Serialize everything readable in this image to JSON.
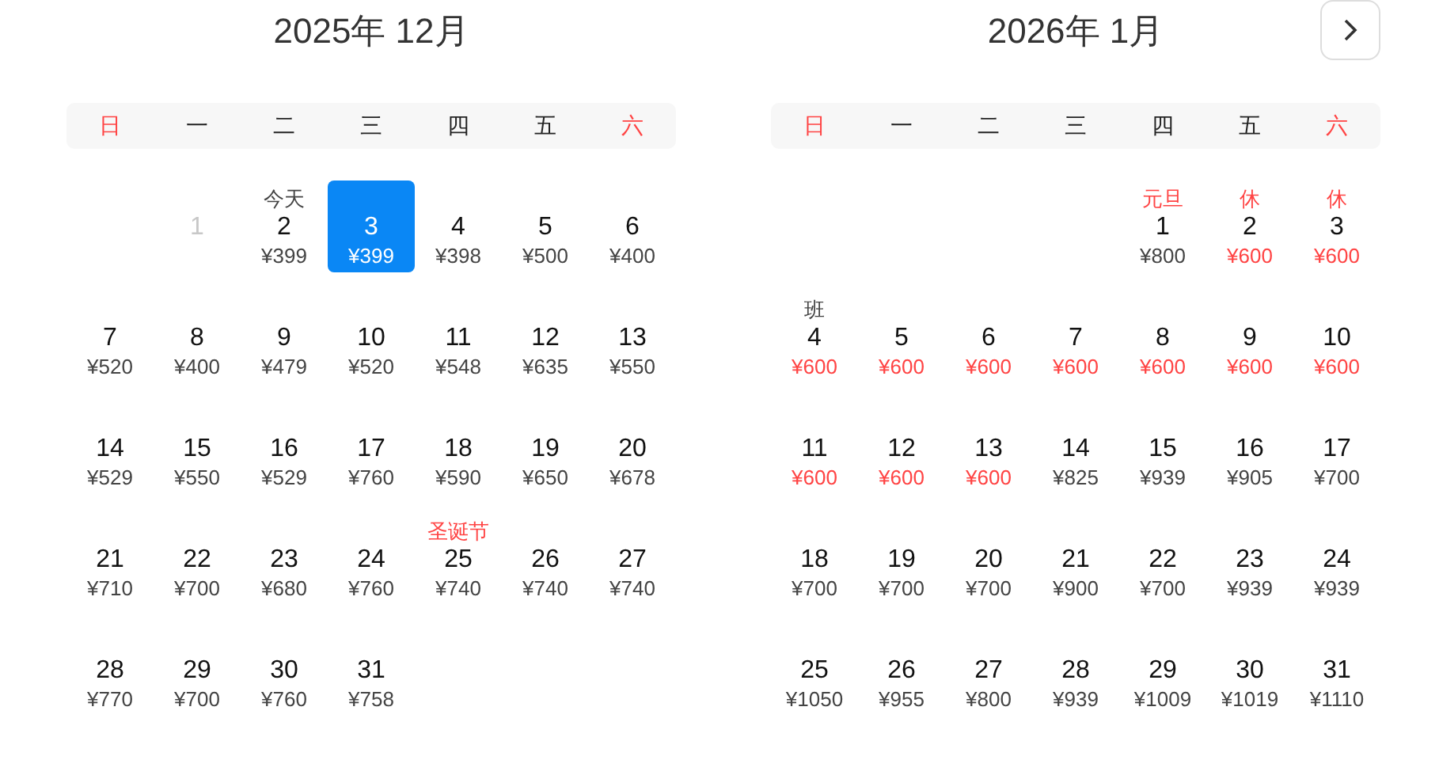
{
  "months": [
    {
      "title": "2025年 12月",
      "weekdays": [
        {
          "label": "日",
          "weekend": true
        },
        {
          "label": "一",
          "weekend": false
        },
        {
          "label": "二",
          "weekend": false
        },
        {
          "label": "三",
          "weekend": false
        },
        {
          "label": "四",
          "weekend": false
        },
        {
          "label": "五",
          "weekend": false
        },
        {
          "label": "六",
          "weekend": true
        }
      ],
      "weeks": [
        [
          {
            "kind": "blank"
          },
          {
            "kind": "date",
            "d": "1",
            "disabled": true,
            "selected": false
          },
          {
            "kind": "date",
            "d": "2",
            "price": "¥399",
            "note": "今天",
            "holiday": false,
            "disabled": false,
            "selected": false,
            "deal": false
          },
          {
            "kind": "date",
            "d": "3",
            "price": "¥399",
            "disabled": false,
            "selected": true,
            "deal": false
          },
          {
            "kind": "date",
            "d": "4",
            "price": "¥398",
            "disabled": false,
            "selected": false,
            "deal": false
          },
          {
            "kind": "date",
            "d": "5",
            "price": "¥500",
            "disabled": false,
            "selected": false,
            "deal": false
          },
          {
            "kind": "date",
            "d": "6",
            "price": "¥400",
            "disabled": false,
            "selected": false,
            "deal": false
          }
        ],
        [
          {
            "kind": "date",
            "d": "7",
            "price": "¥520",
            "disabled": false,
            "selected": false,
            "deal": false
          },
          {
            "kind": "date",
            "d": "8",
            "price": "¥400",
            "disabled": false,
            "selected": false,
            "deal": false
          },
          {
            "kind": "date",
            "d": "9",
            "price": "¥479",
            "disabled": false,
            "selected": false,
            "deal": false
          },
          {
            "kind": "date",
            "d": "10",
            "price": "¥520",
            "disabled": false,
            "selected": false,
            "deal": false
          },
          {
            "kind": "date",
            "d": "11",
            "price": "¥548",
            "disabled": false,
            "selected": false,
            "deal": false
          },
          {
            "kind": "date",
            "d": "12",
            "price": "¥635",
            "disabled": false,
            "selected": false,
            "deal": false
          },
          {
            "kind": "date",
            "d": "13",
            "price": "¥550",
            "disabled": false,
            "selected": false,
            "deal": false
          }
        ],
        [
          {
            "kind": "date",
            "d": "14",
            "price": "¥529",
            "disabled": false,
            "selected": false,
            "deal": false
          },
          {
            "kind": "date",
            "d": "15",
            "price": "¥550",
            "disabled": false,
            "selected": false,
            "deal": false
          },
          {
            "kind": "date",
            "d": "16",
            "price": "¥529",
            "disabled": false,
            "selected": false,
            "deal": false
          },
          {
            "kind": "date",
            "d": "17",
            "price": "¥760",
            "disabled": false,
            "selected": false,
            "deal": false
          },
          {
            "kind": "date",
            "d": "18",
            "price": "¥590",
            "disabled": false,
            "selected": false,
            "deal": false
          },
          {
            "kind": "date",
            "d": "19",
            "price": "¥650",
            "disabled": false,
            "selected": false,
            "deal": false
          },
          {
            "kind": "date",
            "d": "20",
            "price": "¥678",
            "disabled": false,
            "selected": false,
            "deal": false
          }
        ],
        [
          {
            "kind": "date",
            "d": "21",
            "price": "¥710",
            "disabled": false,
            "selected": false,
            "deal": false
          },
          {
            "kind": "date",
            "d": "22",
            "price": "¥700",
            "disabled": false,
            "selected": false,
            "deal": false
          },
          {
            "kind": "date",
            "d": "23",
            "price": "¥680",
            "disabled": false,
            "selected": false,
            "deal": false
          },
          {
            "kind": "date",
            "d": "24",
            "price": "¥760",
            "disabled": false,
            "selected": false,
            "deal": false
          },
          {
            "kind": "date",
            "d": "25",
            "price": "¥740",
            "note": "圣诞节",
            "holiday": true,
            "disabled": false,
            "selected": false,
            "deal": false
          },
          {
            "kind": "date",
            "d": "26",
            "price": "¥740",
            "disabled": false,
            "selected": false,
            "deal": false
          },
          {
            "kind": "date",
            "d": "27",
            "price": "¥740",
            "disabled": false,
            "selected": false,
            "deal": false
          }
        ],
        [
          {
            "kind": "date",
            "d": "28",
            "price": "¥770",
            "disabled": false,
            "selected": false,
            "deal": false
          },
          {
            "kind": "date",
            "d": "29",
            "price": "¥700",
            "disabled": false,
            "selected": false,
            "deal": false
          },
          {
            "kind": "date",
            "d": "30",
            "price": "¥760",
            "disabled": false,
            "selected": false,
            "deal": false
          },
          {
            "kind": "date",
            "d": "31",
            "price": "¥758",
            "disabled": false,
            "selected": false,
            "deal": false
          }
        ]
      ]
    },
    {
      "title": "2026年 1月",
      "weekdays": [
        {
          "label": "日",
          "weekend": true
        },
        {
          "label": "一",
          "weekend": false
        },
        {
          "label": "二",
          "weekend": false
        },
        {
          "label": "三",
          "weekend": false
        },
        {
          "label": "四",
          "weekend": false
        },
        {
          "label": "五",
          "weekend": false
        },
        {
          "label": "六",
          "weekend": true
        }
      ],
      "weeks": [
        [
          {
            "kind": "blank"
          },
          {
            "kind": "blank"
          },
          {
            "kind": "blank"
          },
          {
            "kind": "blank"
          },
          {
            "kind": "date",
            "d": "1",
            "price": "¥800",
            "note": "元旦",
            "holiday": true,
            "disabled": false,
            "selected": false,
            "deal": false
          },
          {
            "kind": "date",
            "d": "2",
            "price": "¥600",
            "note": "休",
            "holiday": true,
            "disabled": false,
            "selected": false,
            "deal": true
          },
          {
            "kind": "date",
            "d": "3",
            "price": "¥600",
            "note": "休",
            "holiday": true,
            "disabled": false,
            "selected": false,
            "deal": true
          }
        ],
        [
          {
            "kind": "date",
            "d": "4",
            "price": "¥600",
            "note": "班",
            "holiday": false,
            "disabled": false,
            "selected": false,
            "deal": true
          },
          {
            "kind": "date",
            "d": "5",
            "price": "¥600",
            "disabled": false,
            "selected": false,
            "deal": true
          },
          {
            "kind": "date",
            "d": "6",
            "price": "¥600",
            "disabled": false,
            "selected": false,
            "deal": true
          },
          {
            "kind": "date",
            "d": "7",
            "price": "¥600",
            "disabled": false,
            "selected": false,
            "deal": true
          },
          {
            "kind": "date",
            "d": "8",
            "price": "¥600",
            "disabled": false,
            "selected": false,
            "deal": true
          },
          {
            "kind": "date",
            "d": "9",
            "price": "¥600",
            "disabled": false,
            "selected": false,
            "deal": true
          },
          {
            "kind": "date",
            "d": "10",
            "price": "¥600",
            "disabled": false,
            "selected": false,
            "deal": true
          }
        ],
        [
          {
            "kind": "date",
            "d": "11",
            "price": "¥600",
            "disabled": false,
            "selected": false,
            "deal": true
          },
          {
            "kind": "date",
            "d": "12",
            "price": "¥600",
            "disabled": false,
            "selected": false,
            "deal": true
          },
          {
            "kind": "date",
            "d": "13",
            "price": "¥600",
            "disabled": false,
            "selected": false,
            "deal": true
          },
          {
            "kind": "date",
            "d": "14",
            "price": "¥825",
            "disabled": false,
            "selected": false,
            "deal": false
          },
          {
            "kind": "date",
            "d": "15",
            "price": "¥939",
            "disabled": false,
            "selected": false,
            "deal": false
          },
          {
            "kind": "date",
            "d": "16",
            "price": "¥905",
            "disabled": false,
            "selected": false,
            "deal": false
          },
          {
            "kind": "date",
            "d": "17",
            "price": "¥700",
            "disabled": false,
            "selected": false,
            "deal": false
          }
        ],
        [
          {
            "kind": "date",
            "d": "18",
            "price": "¥700",
            "disabled": false,
            "selected": false,
            "deal": false
          },
          {
            "kind": "date",
            "d": "19",
            "price": "¥700",
            "disabled": false,
            "selected": false,
            "deal": false
          },
          {
            "kind": "date",
            "d": "20",
            "price": "¥700",
            "disabled": false,
            "selected": false,
            "deal": false
          },
          {
            "kind": "date",
            "d": "21",
            "price": "¥900",
            "disabled": false,
            "selected": false,
            "deal": false
          },
          {
            "kind": "date",
            "d": "22",
            "price": "¥700",
            "disabled": false,
            "selected": false,
            "deal": false
          },
          {
            "kind": "date",
            "d": "23",
            "price": "¥939",
            "disabled": false,
            "selected": false,
            "deal": false
          },
          {
            "kind": "date",
            "d": "24",
            "price": "¥939",
            "disabled": false,
            "selected": false,
            "deal": false
          }
        ],
        [
          {
            "kind": "date",
            "d": "25",
            "price": "¥1050",
            "disabled": false,
            "selected": false,
            "deal": false
          },
          {
            "kind": "date",
            "d": "26",
            "price": "¥955",
            "disabled": false,
            "selected": false,
            "deal": false
          },
          {
            "kind": "date",
            "d": "27",
            "price": "¥800",
            "disabled": false,
            "selected": false,
            "deal": false
          },
          {
            "kind": "date",
            "d": "28",
            "price": "¥939",
            "disabled": false,
            "selected": false,
            "deal": false
          },
          {
            "kind": "date",
            "d": "29",
            "price": "¥1009",
            "disabled": false,
            "selected": false,
            "deal": false
          },
          {
            "kind": "date",
            "d": "30",
            "price": "¥1019",
            "disabled": false,
            "selected": false,
            "deal": false
          },
          {
            "kind": "date",
            "d": "31",
            "price": "¥1110",
            "disabled": false,
            "selected": false,
            "deal": false
          }
        ]
      ]
    }
  ]
}
